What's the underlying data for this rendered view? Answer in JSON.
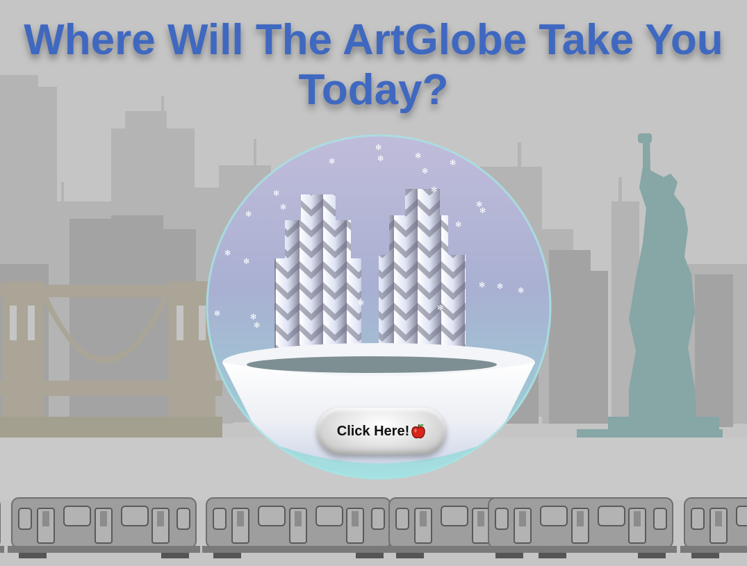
{
  "page": {
    "title": "Where Will The ArtGlobe Take You Today?"
  },
  "globe": {
    "cta_label": "Click Here!",
    "cta_icon": "red-apple-icon"
  },
  "background": {
    "scene": "city-skyline",
    "landmarks": [
      "bridge-icon",
      "skyscraper-icon",
      "statue-of-liberty-icon"
    ],
    "train_cars": 5
  },
  "colors": {
    "background": "#c5c5c5",
    "title": "#3f68c0",
    "bridge": "#a9a596",
    "statue": "#88a7a7",
    "buildings_dark": "#a8a8a8",
    "buildings_light": "#b8b8b8",
    "globe_top": "#b9b3d6",
    "globe_bottom": "#9fc8d6",
    "globe_rim": "#a6e2e2",
    "train": "#9b9b9b"
  }
}
